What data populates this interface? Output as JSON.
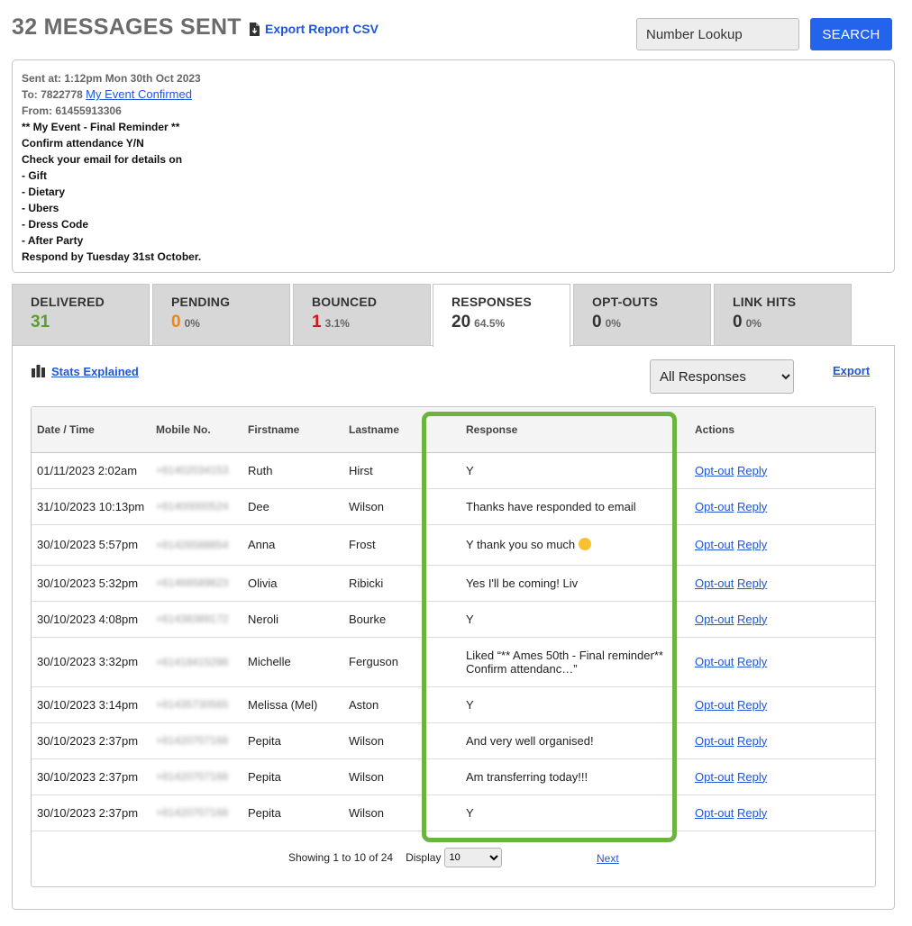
{
  "header": {
    "title": "32 MESSAGES SENT",
    "export_csv": "Export Report CSV",
    "lookup_placeholder": "Number Lookup",
    "search_label": "SEARCH"
  },
  "message": {
    "sent_at": "Sent at: 1:12pm Mon 30th Oct 2023",
    "to_prefix": "To: 7822778",
    "to_link": "My Event Confirmed",
    "from": "From: 61455913306",
    "body_lines": [
      "** My Event - Final Reminder **",
      "Confirm attendance Y/N",
      "Check your email for details on",
      "- Gift",
      "- Dietary",
      "- Ubers",
      "- Dress Code",
      "- After Party",
      "Respond by Tuesday 31st October."
    ]
  },
  "tabs": [
    {
      "name": "DELIVERED",
      "value": "31",
      "pct": "",
      "color": "#5a9e2f"
    },
    {
      "name": "PENDING",
      "value": "0",
      "pct": "0%",
      "color": "#f0860a"
    },
    {
      "name": "BOUNCED",
      "value": "1",
      "pct": "3.1%",
      "color": "#d9141e"
    },
    {
      "name": "RESPONSES",
      "value": "20",
      "pct": "64.5%",
      "color": "#333333"
    },
    {
      "name": "OPT-OUTS",
      "value": "0",
      "pct": "0%",
      "color": "#333333"
    },
    {
      "name": "LINK HITS",
      "value": "0",
      "pct": "0%",
      "color": "#333333"
    }
  ],
  "toolbar": {
    "stats_explained": "Stats Explained",
    "filter_selected": "All Responses",
    "export": "Export"
  },
  "table": {
    "headers": [
      "Date / Time",
      "Mobile No.",
      "Firstname",
      "Lastname",
      "Response",
      "Actions"
    ],
    "optout_label": "Opt-out",
    "reply_label": "Reply",
    "rows": [
      {
        "date": "01/11/2023 2:02am",
        "mobile": "+61402034153",
        "first": "Ruth",
        "last": "Hirst",
        "response": "Y"
      },
      {
        "date": "31/10/2023 10:13pm",
        "mobile": "+61400000524",
        "first": "Dee",
        "last": "Wilson",
        "response": "Thanks have responded to email"
      },
      {
        "date": "30/10/2023 5:57pm",
        "mobile": "+61426588854",
        "first": "Anna",
        "last": "Frost",
        "response": "Y thank you so much"
      },
      {
        "date": "30/10/2023 5:32pm",
        "mobile": "+61466589823",
        "first": "Olivia",
        "last": "Ribicki",
        "response": "Yes I'll be coming! Liv"
      },
      {
        "date": "30/10/2023 4:08pm",
        "mobile": "+61438389172",
        "first": "Neroli",
        "last": "Bourke",
        "response": "Y"
      },
      {
        "date": "30/10/2023 3:32pm",
        "mobile": "+61418415286",
        "first": "Michelle",
        "last": "Ferguson",
        "response": "Liked “** Ames 50th - Final reminder** Confirm attendanc…”"
      },
      {
        "date": "30/10/2023 3:14pm",
        "mobile": "+61435730565",
        "first": "Melissa (Mel)",
        "last": "Aston",
        "response": "Y"
      },
      {
        "date": "30/10/2023 2:37pm",
        "mobile": "+61420707166",
        "first": "Pepita",
        "last": "Wilson",
        "response": "And very well organised!"
      },
      {
        "date": "30/10/2023 2:37pm",
        "mobile": "+61420707166",
        "first": "Pepita",
        "last": "Wilson",
        "response": "Am transferring today!!!"
      },
      {
        "date": "30/10/2023 2:37pm",
        "mobile": "+61420707166",
        "first": "Pepita",
        "last": "Wilson",
        "response": "Y"
      }
    ]
  },
  "pager": {
    "showing": "Showing 1 to 10 of 24",
    "display_label": "Display",
    "display_value": "10",
    "next": "Next"
  },
  "colors": {
    "accent": "#2463eb",
    "highlight": "#6db33f"
  }
}
